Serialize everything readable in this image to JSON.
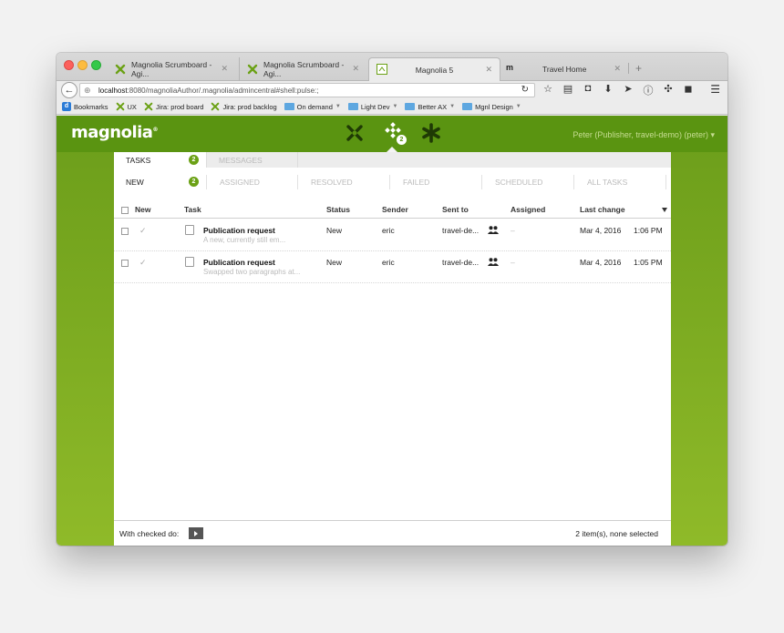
{
  "browser": {
    "tabs": [
      {
        "label": "Magnolia Scrumboard - Agi...",
        "close": "✕"
      },
      {
        "label": "Magnolia Scrumboard - Agi...",
        "close": "✕"
      },
      {
        "label": "Magnolia 5",
        "close": "✕"
      },
      {
        "label": "Travel Home",
        "close": "✕"
      }
    ],
    "new_tab": "+",
    "url_host": "localhost",
    "url_rest": ":8080/magnoliaAuthor/.magnolia/admincentral#shell:pulse:;",
    "bookmarks": [
      {
        "label": "Bookmarks",
        "type": "root"
      },
      {
        "label": "UX",
        "type": "magnolia"
      },
      {
        "label": "Jira: prod board",
        "type": "magnolia"
      },
      {
        "label": "Jira: prod backlog",
        "type": "magnolia"
      },
      {
        "label": "On demand",
        "type": "folder",
        "dropdown": true
      },
      {
        "label": "Light Dev",
        "type": "folder",
        "dropdown": true
      },
      {
        "label": "Better AX",
        "type": "folder",
        "dropdown": true
      },
      {
        "label": "Mgnl Design",
        "type": "folder",
        "dropdown": true
      }
    ],
    "bookmark_badge": "d",
    "tab4_icon": "m"
  },
  "app": {
    "logo": "magnolia",
    "logo_mark": "®",
    "pulse_badge": "2",
    "user": "Peter (Publisher, travel-demo) (peter)",
    "user_dropdown": "▾",
    "subtabs": {
      "tasks": "TASKS",
      "tasks_count": "2",
      "messages": "MESSAGES"
    },
    "filters": {
      "new": "NEW",
      "new_count": "2",
      "assigned": "ASSIGNED",
      "resolved": "RESOLVED",
      "failed": "FAILED",
      "scheduled": "SCHEDULED",
      "all": "ALL TASKS"
    },
    "columns": {
      "new": "New",
      "task": "Task",
      "status": "Status",
      "sender": "Sender",
      "sent_to": "Sent to",
      "assigned": "Assigned",
      "last_change": "Last change"
    },
    "rows": [
      {
        "title": "Publication request",
        "desc": "A new, currently still em...",
        "status": "New",
        "sender": "eric",
        "sent_to": "travel-de...",
        "assigned": "–",
        "date": "Mar 4, 2016",
        "time": "1:06 PM"
      },
      {
        "title": "Publication request",
        "desc": "Swapped two paragraphs at...",
        "status": "New",
        "sender": "eric",
        "sent_to": "travel-de...",
        "assigned": "–",
        "date": "Mar 4, 2016",
        "time": "1:05 PM"
      }
    ],
    "footer": {
      "with_checked": "With checked do:",
      "count": "2 item(s), none selected"
    }
  },
  "colors": {
    "header_green": "#5a9411",
    "badge_green": "#6ba115"
  }
}
